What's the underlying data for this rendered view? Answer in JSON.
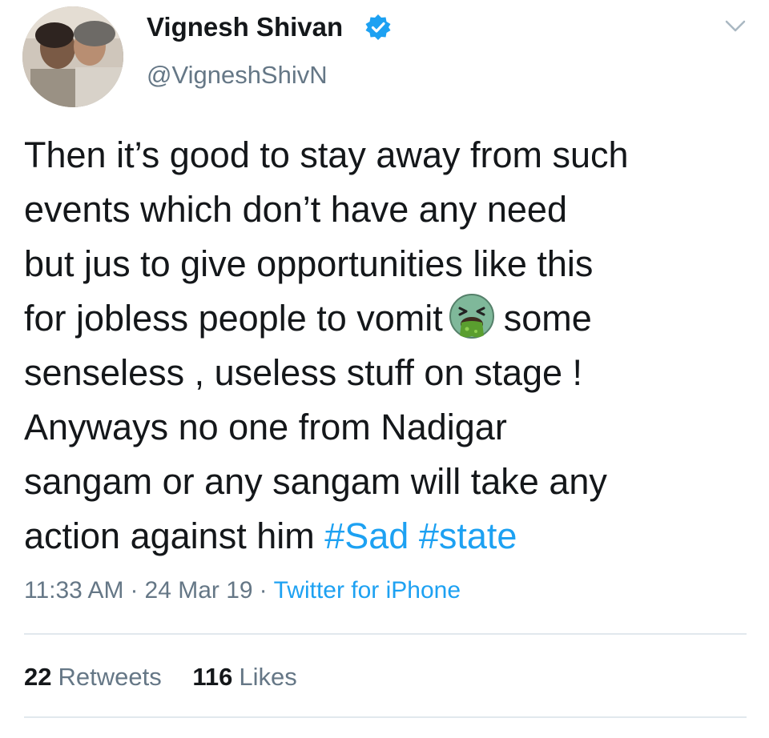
{
  "user": {
    "display_name": "Vignesh Shivan",
    "handle": "@VigneshShivN",
    "verified": true
  },
  "tweet": {
    "lines": [
      "Then it’s good to stay away from such",
      "events which don’t have any need",
      "but jus to give opportunities like this",
      "for jobless people to vomit",
      "some",
      "senseless , useless stuff on stage !",
      "Anyways no one from Nadigar",
      "sangam or any sangam will take any",
      "action against him"
    ],
    "emoji": "face-vomiting-icon",
    "hashtags": [
      "#Sad",
      "#state"
    ]
  },
  "meta": {
    "time": "11:33 AM",
    "date": "24 Mar 19",
    "separator": "·",
    "source": "Twitter for iPhone"
  },
  "stats": {
    "retweets_count": "22",
    "retweets_label": "Retweets",
    "likes_count": "116",
    "likes_label": "Likes"
  },
  "colors": {
    "text": "#14171a",
    "secondary": "#657786",
    "link": "#1da1f2",
    "divider": "#e1e8ed"
  }
}
